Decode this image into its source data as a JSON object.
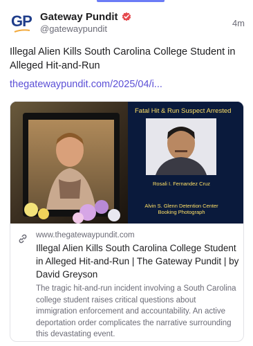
{
  "author": {
    "name": "Gateway Pundit",
    "handle": "@gatewaypundit",
    "avatar_text": "GP",
    "timestamp": "4m"
  },
  "post": {
    "text": "Illegal Alien Kills South Carolina College Student in Alleged Hit-and-Run",
    "link_text": "thegatewaypundit.com/2025/04/i..."
  },
  "card": {
    "image": {
      "headline": "Fatal Hit & Run Suspect Arrested",
      "suspect_name": "Rosali I. Fernandez Cruz",
      "detention_line1": "Alvin S. Glenn Detention Center",
      "detention_line2": "Booking Photograph"
    },
    "domain": "www.thegatewaypundit.com",
    "title": "Illegal Alien Kills South Carolina College Student in Alleged Hit-and-Run | The Gateway Pundit | by David Greyson",
    "description": "The tragic hit-and-run incident involving a South Carolina college student raises critical questions about immigration enforcement and accountability. An active deportation order complicates the narrative surrounding this devastating event."
  },
  "colors": {
    "accent": "#6b7cf6",
    "link": "#5b4fd6",
    "verified": "#e5484d",
    "brand_navy": "#1f3d8a",
    "brand_orange": "#f2a93b",
    "image_caption_yellow": "#ffe066"
  },
  "icons": {
    "verified": "verified-badge-icon",
    "link": "chain-link-icon"
  }
}
